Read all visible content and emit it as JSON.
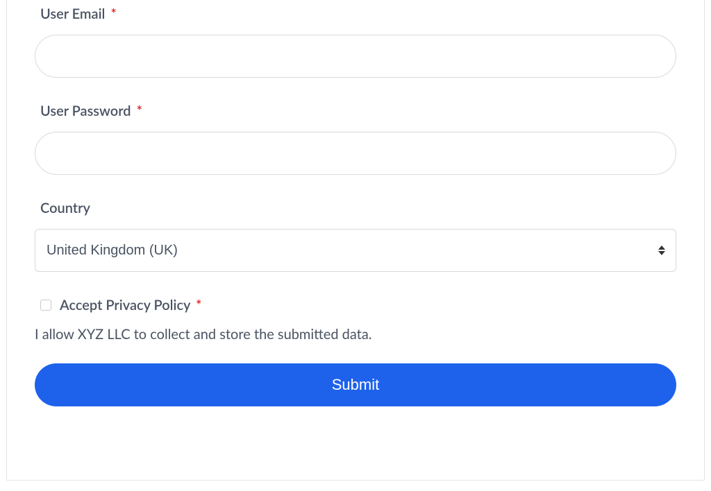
{
  "form": {
    "email": {
      "label": "User Email",
      "required_marker": "*",
      "value": ""
    },
    "password": {
      "label": "User Password",
      "required_marker": "*",
      "value": ""
    },
    "country": {
      "label": "Country",
      "selected": "United Kingdom (UK)"
    },
    "privacy": {
      "label": "Accept Privacy Policy",
      "required_marker": "*",
      "checked": false,
      "consent_text": "I allow XYZ LLC to collect and store the submitted data."
    },
    "submit_label": "Submit"
  }
}
